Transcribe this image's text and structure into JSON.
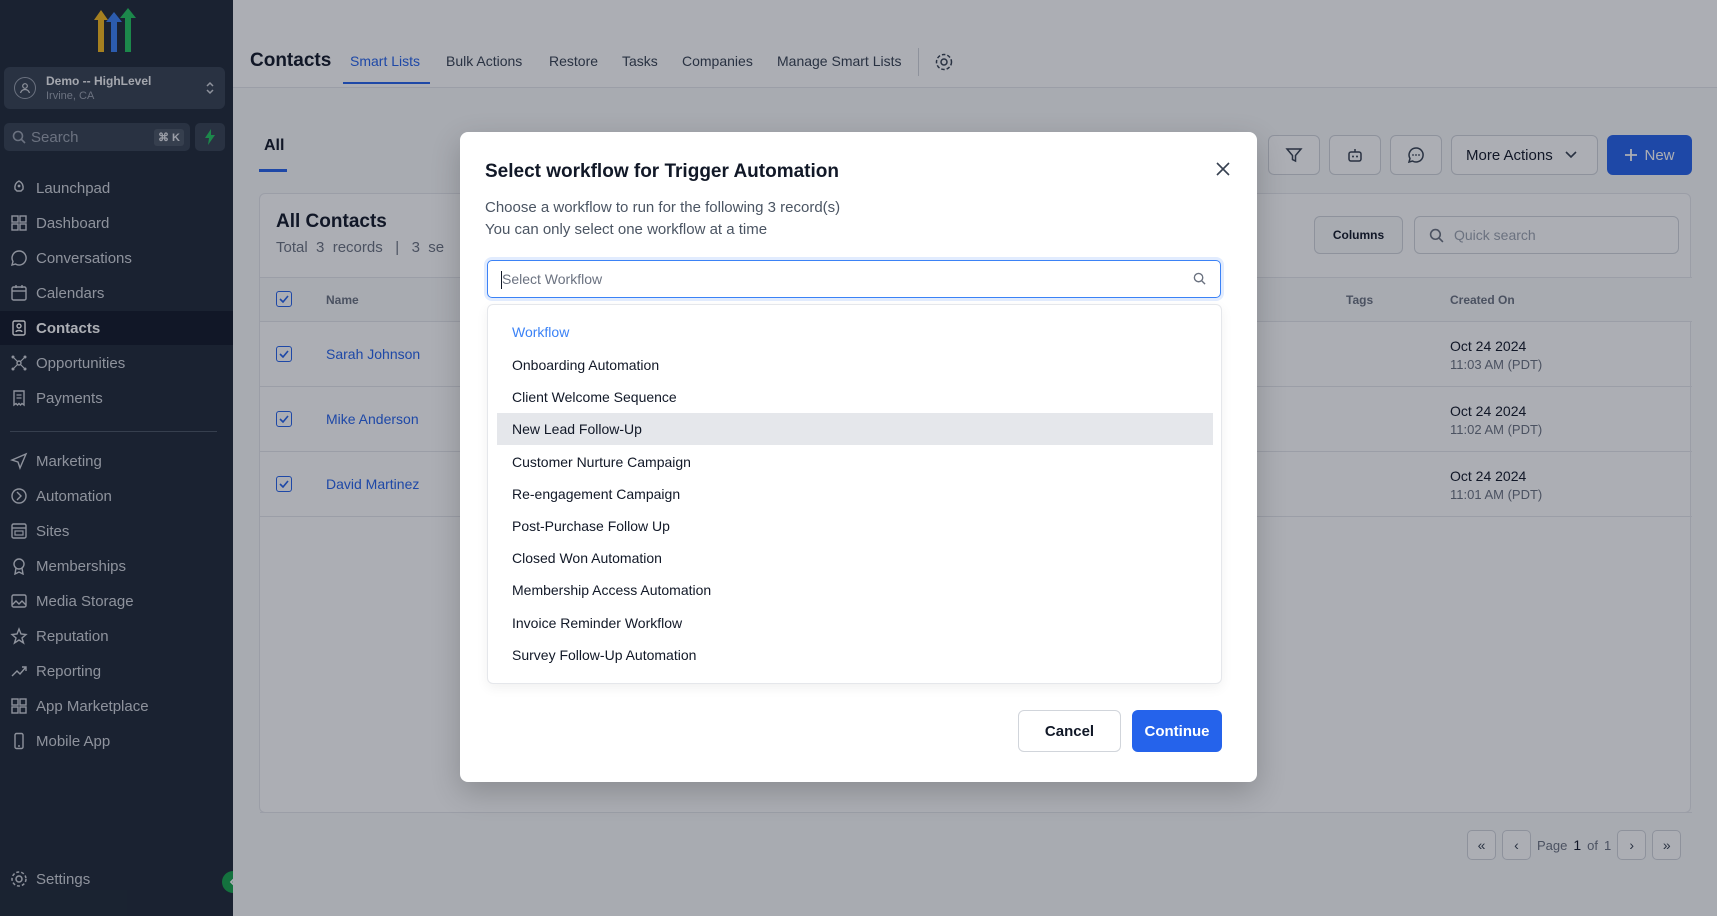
{
  "account": {
    "name": "Demo -- HighLevel",
    "location": "Irvine, CA"
  },
  "sidebar": {
    "search_label": "Search",
    "search_shortcut": "⌘ K",
    "items": [
      {
        "label": "Launchpad",
        "icon": "rocket-icon"
      },
      {
        "label": "Dashboard",
        "icon": "grid-icon"
      },
      {
        "label": "Conversations",
        "icon": "chat-icon"
      },
      {
        "label": "Calendars",
        "icon": "calendar-icon"
      },
      {
        "label": "Contacts",
        "icon": "contacts-icon"
      },
      {
        "label": "Opportunities",
        "icon": "network-icon"
      },
      {
        "label": "Payments",
        "icon": "receipt-icon"
      },
      {
        "label": "Marketing",
        "icon": "send-icon"
      },
      {
        "label": "Automation",
        "icon": "automation-icon"
      },
      {
        "label": "Sites",
        "icon": "sites-icon"
      },
      {
        "label": "Memberships",
        "icon": "award-icon"
      },
      {
        "label": "Media Storage",
        "icon": "image-icon"
      },
      {
        "label": "Reputation",
        "icon": "star-icon"
      },
      {
        "label": "Reporting",
        "icon": "trend-icon"
      },
      {
        "label": "App Marketplace",
        "icon": "apps-icon"
      },
      {
        "label": "Mobile App",
        "icon": "phone-icon"
      }
    ],
    "active": "Contacts",
    "settings_label": "Settings"
  },
  "header": {
    "title": "Contacts",
    "tabs": [
      "Smart Lists",
      "Bulk Actions",
      "Restore",
      "Tasks",
      "Companies",
      "Manage Smart Lists"
    ],
    "active_tab": "Smart Lists"
  },
  "toolbar": {
    "subtab_all": "All",
    "more_actions": "More Actions",
    "new_label": "New"
  },
  "list": {
    "title": "All Contacts",
    "subtitle": "Total  3  records   |   3  se",
    "columns_btn": "Columns",
    "quick_search_placeholder": "Quick search",
    "headers": {
      "name": "Name",
      "tags": "Tags",
      "created_on": "Created On"
    },
    "rows": [
      {
        "name": "Sarah Johnson",
        "date": "Oct 24 2024",
        "time": "11:03 AM (PDT)"
      },
      {
        "name": "Mike Anderson",
        "date": "Oct 24 2024",
        "time": "11:02 AM (PDT)"
      },
      {
        "name": "David Martinez",
        "date": "Oct 24 2024",
        "time": "11:01 AM (PDT)"
      }
    ]
  },
  "pagination": {
    "page_label": "Page",
    "page": "1",
    "of_label": "of",
    "total": "1"
  },
  "modal": {
    "title": "Select workflow for Trigger Automation",
    "desc1": "Choose a workflow to run for the following 3 record(s)",
    "desc2": "You can only select one workflow at a time",
    "select_placeholder": "Select Workflow",
    "group_header": "Workflow",
    "options": [
      "Onboarding Automation",
      "Client Welcome Sequence",
      "New Lead Follow-Up",
      "Customer Nurture Campaign",
      "Re-engagement Campaign",
      "Post-Purchase Follow Up",
      "Closed Won Automation",
      "Membership Access Automation",
      "Invoice Reminder Workflow",
      "Survey Follow-Up Automation"
    ],
    "hovered_option": "New Lead Follow-Up",
    "cancel_label": "Cancel",
    "continue_label": "Continue"
  },
  "colors": {
    "accent": "#2563eb",
    "sidebar_bg": "#1f2937",
    "success": "#16a34a"
  }
}
